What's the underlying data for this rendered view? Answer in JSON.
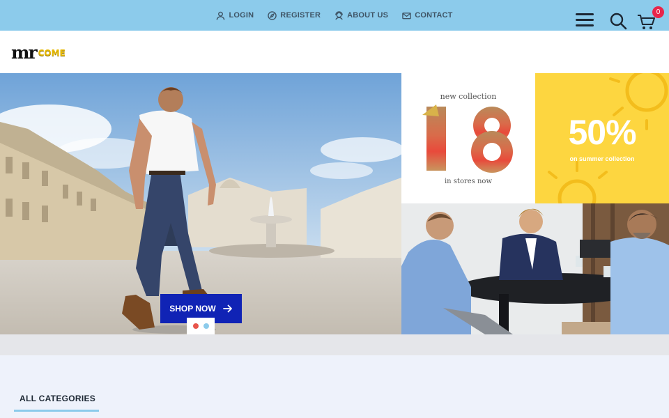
{
  "topbar": {
    "links": [
      {
        "label": "LOGIN",
        "icon": "user-icon"
      },
      {
        "label": "REGISTER",
        "icon": "compass-icon"
      },
      {
        "label": "ABOUT US",
        "icon": "support-icon"
      },
      {
        "label": "CONTACT",
        "icon": "mail-icon"
      }
    ]
  },
  "header": {
    "logo_mr": "mr",
    "logo_come": "COME",
    "menu_icon": "hamburger-icon",
    "search_icon": "search-icon",
    "cart_icon": "cart-icon",
    "cart_count": "0"
  },
  "hero": {
    "button_label": "SHOP NOW",
    "button_icon": "arrow-right-icon",
    "dots": [
      "#e8554b",
      "#8ccbeb"
    ]
  },
  "promos": {
    "collection_top": "new collection",
    "collection_number": "18",
    "collection_bottom": "in stores now",
    "sale_big": "50%",
    "sale_small": "on summer collection"
  },
  "categories": {
    "title": "ALL CATEGORIES"
  },
  "colors": {
    "topbar": "#8ccbeb",
    "button": "#1023b5",
    "badge": "#e8254b",
    "sale_bg": "#fdd640"
  }
}
